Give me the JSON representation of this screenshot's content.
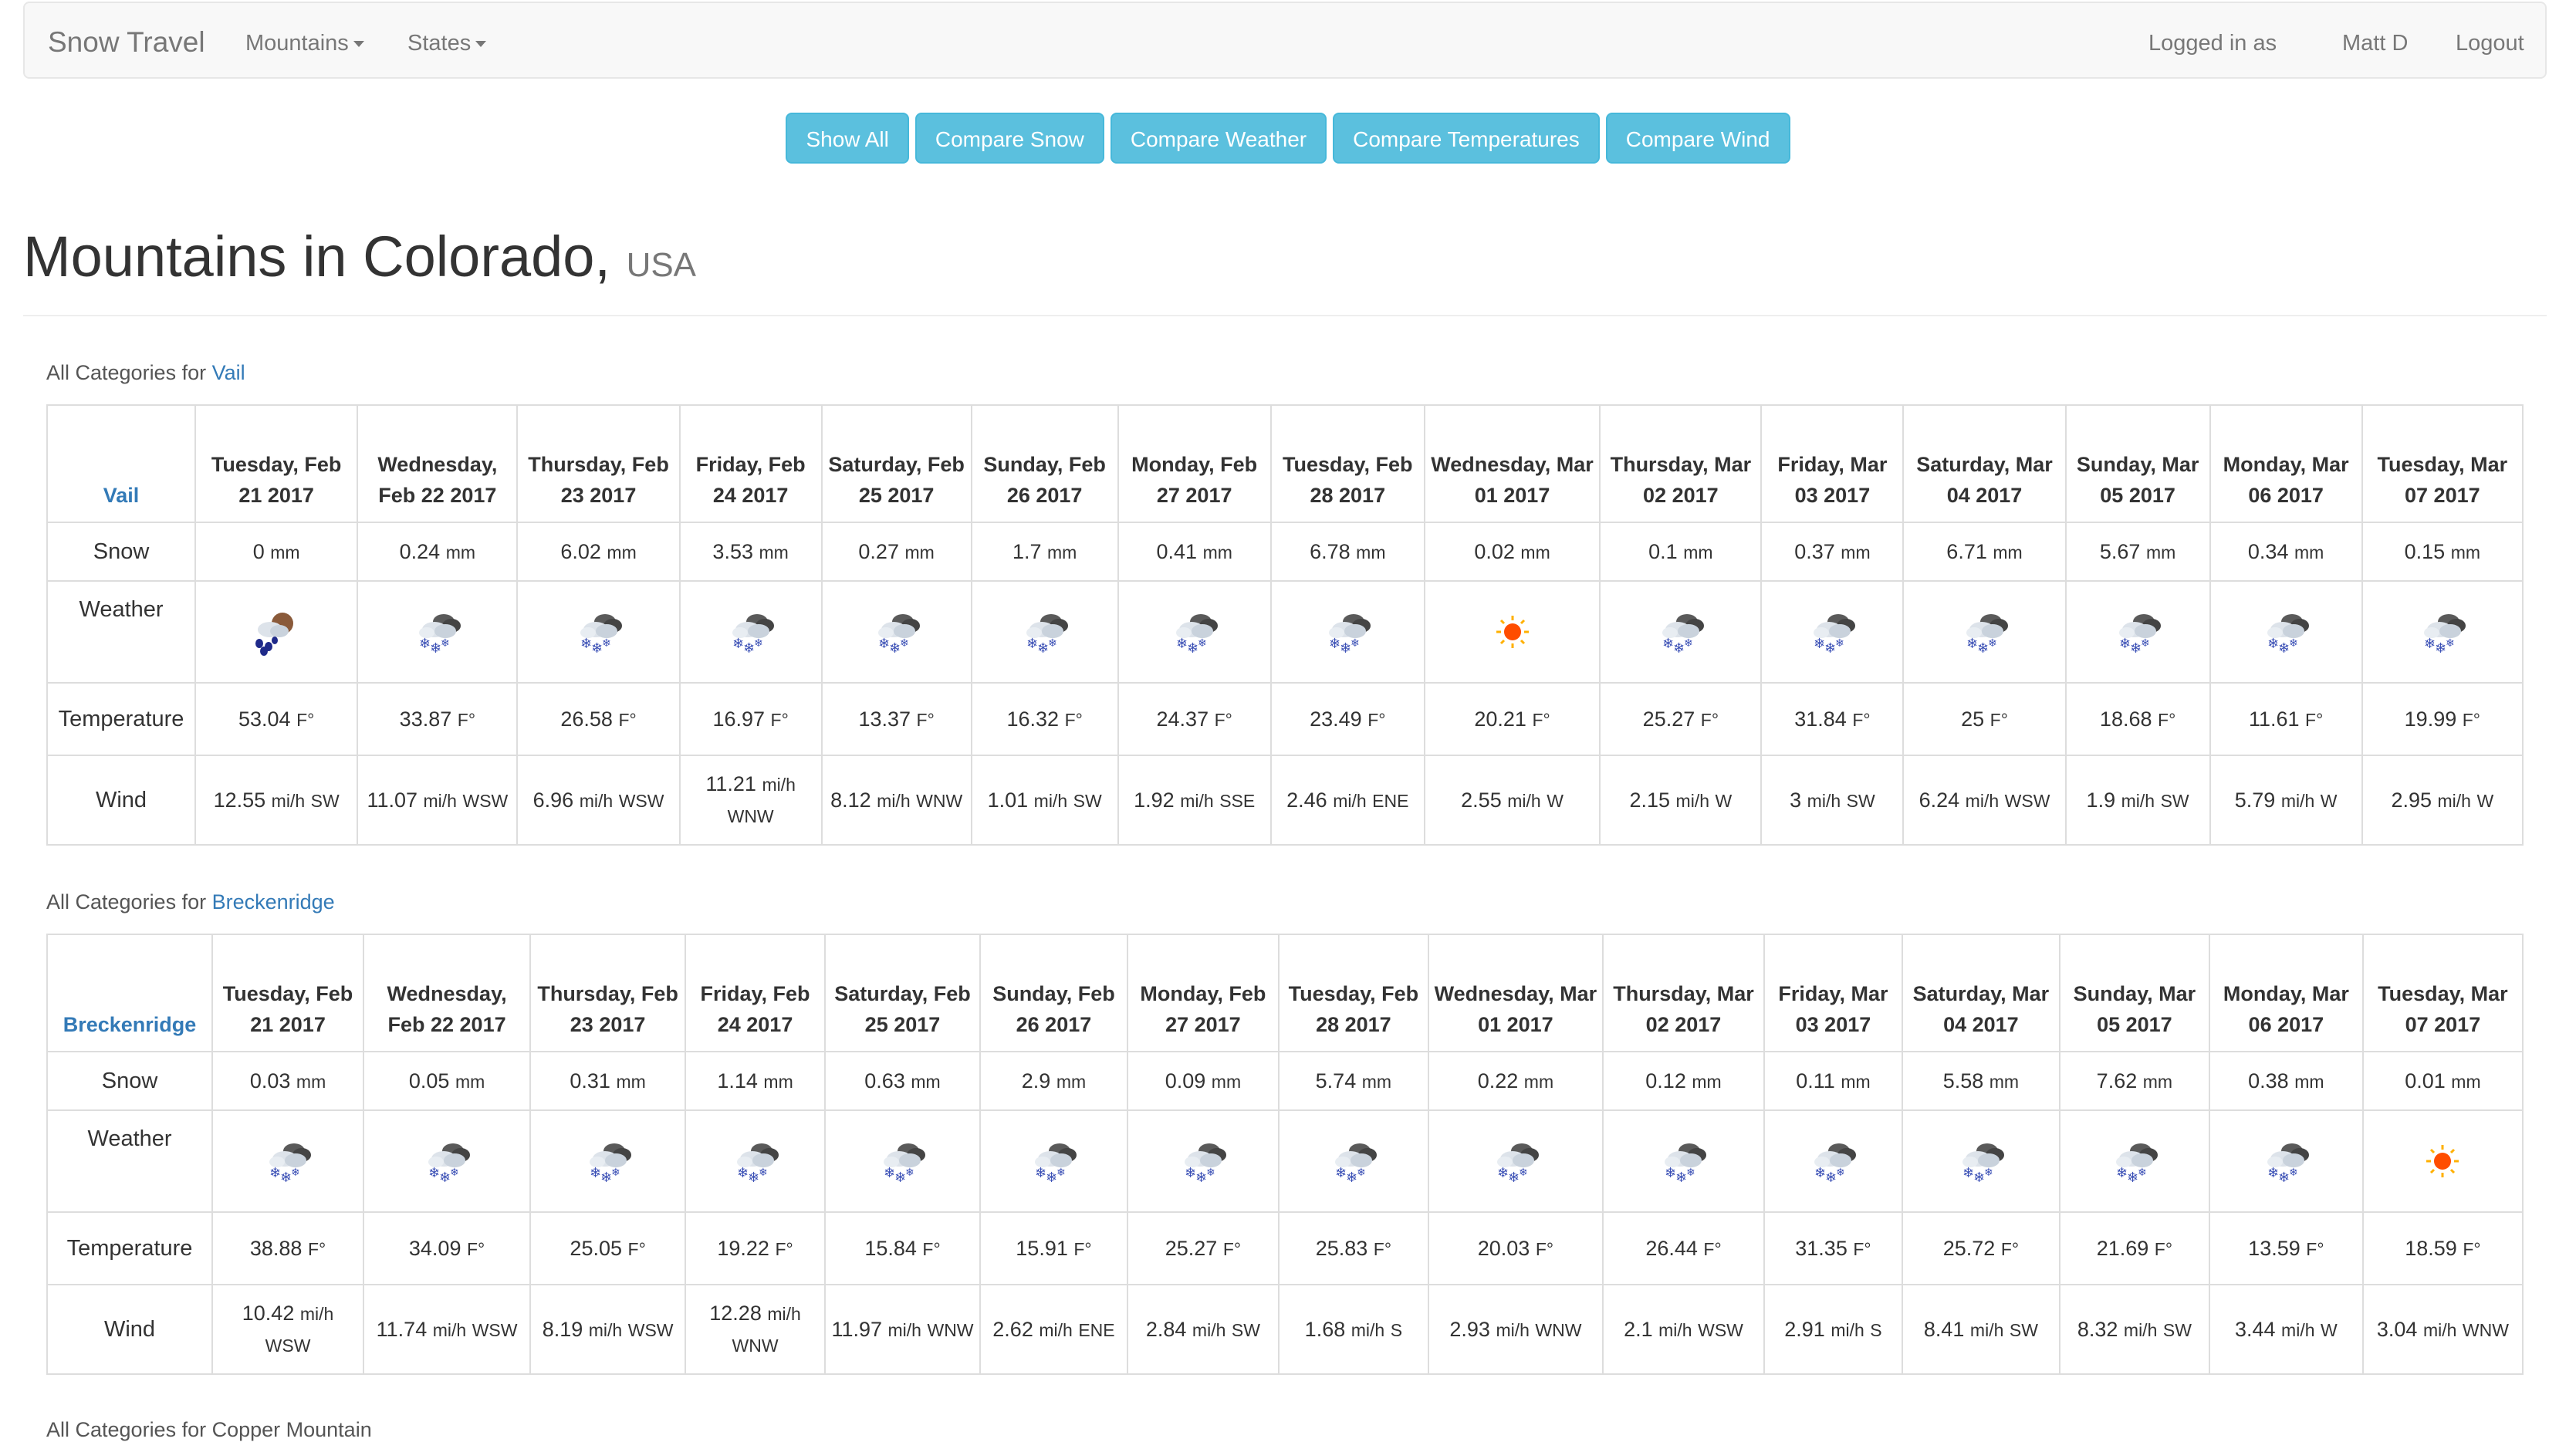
{
  "navbar": {
    "brand": "Snow Travel",
    "mountains_label": "Mountains",
    "states_label": "States",
    "logged_in_as": "Logged in as",
    "user_name": "Matt D",
    "logout": "Logout"
  },
  "buttons": [
    "Show All",
    "Compare Snow",
    "Compare Weather",
    "Compare Temperatures",
    "Compare Wind"
  ],
  "heading": {
    "title": "Mountains in Colorado,",
    "subtitle": "USA"
  },
  "row_labels": {
    "snow": "Snow",
    "weather": "Weather",
    "temperature": "Temperature",
    "wind": "Wind"
  },
  "units": {
    "snow": "mm",
    "temp": "F°",
    "wind": "mi/h"
  },
  "sections": [
    {
      "prefix": "All Categories for",
      "mountain": "Vail",
      "days": [
        "Tuesday, Feb 21 2017",
        "Wednesday, Feb 22 2017",
        "Thursday, Feb 23 2017",
        "Friday, Feb 24 2017",
        "Saturday, Feb 25 2017",
        "Sunday, Feb 26 2017",
        "Monday, Feb 27 2017",
        "Tuesday, Feb 28 2017",
        "Wednesday, Mar 01 2017",
        "Thursday, Mar 02 2017",
        "Friday, Mar 03 2017",
        "Saturday, Mar 04 2017",
        "Sunday, Mar 05 2017",
        "Monday, Mar 06 2017",
        "Tuesday, Mar 07 2017"
      ],
      "snow": [
        "0",
        "0.24",
        "6.02",
        "3.53",
        "0.27",
        "1.7",
        "0.41",
        "6.78",
        "0.02",
        "0.1",
        "0.37",
        "6.71",
        "5.67",
        "0.34",
        "0.15"
      ],
      "weather": [
        "rain-cloud-icon",
        "snow-cloud-icon",
        "snow-cloud-icon",
        "snow-cloud-icon",
        "snow-cloud-icon",
        "snow-cloud-icon",
        "snow-cloud-icon",
        "snow-cloud-icon",
        "sun-icon",
        "snow-cloud-icon",
        "snow-cloud-icon",
        "snow-cloud-icon",
        "snow-cloud-icon",
        "snow-cloud-icon",
        "snow-cloud-icon"
      ],
      "temp": [
        "53.04",
        "33.87",
        "26.58",
        "16.97",
        "13.37",
        "16.32",
        "24.37",
        "23.49",
        "20.21",
        "25.27",
        "31.84",
        "25",
        "18.68",
        "11.61",
        "19.99"
      ],
      "wind_speed": [
        "12.55",
        "11.07",
        "6.96",
        "11.21",
        "8.12",
        "1.01",
        "1.92",
        "2.46",
        "2.55",
        "2.15",
        "3",
        "6.24",
        "1.9",
        "5.79",
        "2.95"
      ],
      "wind_dir": [
        "SW",
        "WSW",
        "WSW",
        "WNW",
        "WNW",
        "SW",
        "SSE",
        "ENE",
        "W",
        "W",
        "SW",
        "WSW",
        "SW",
        "W",
        "W"
      ]
    },
    {
      "prefix": "All Categories for",
      "mountain": "Breckenridge",
      "days": [
        "Tuesday, Feb 21 2017",
        "Wednesday, Feb 22 2017",
        "Thursday, Feb 23 2017",
        "Friday, Feb 24 2017",
        "Saturday, Feb 25 2017",
        "Sunday, Feb 26 2017",
        "Monday, Feb 27 2017",
        "Tuesday, Feb 28 2017",
        "Wednesday, Mar 01 2017",
        "Thursday, Mar 02 2017",
        "Friday, Mar 03 2017",
        "Saturday, Mar 04 2017",
        "Sunday, Mar 05 2017",
        "Monday, Mar 06 2017",
        "Tuesday, Mar 07 2017"
      ],
      "snow": [
        "0.03",
        "0.05",
        "0.31",
        "1.14",
        "0.63",
        "2.9",
        "0.09",
        "5.74",
        "0.22",
        "0.12",
        "0.11",
        "5.58",
        "7.62",
        "0.38",
        "0.01"
      ],
      "weather": [
        "snow-cloud-icon",
        "snow-cloud-icon",
        "snow-cloud-icon",
        "snow-cloud-icon",
        "snow-cloud-icon",
        "snow-cloud-icon",
        "snow-cloud-icon",
        "snow-cloud-icon",
        "snow-cloud-icon",
        "snow-cloud-icon",
        "snow-cloud-icon",
        "snow-cloud-icon",
        "snow-cloud-icon",
        "snow-cloud-icon",
        "sun-icon"
      ],
      "temp": [
        "38.88",
        "34.09",
        "25.05",
        "19.22",
        "15.84",
        "15.91",
        "25.27",
        "25.83",
        "20.03",
        "26.44",
        "31.35",
        "25.72",
        "21.69",
        "13.59",
        "18.59"
      ],
      "wind_speed": [
        "10.42",
        "11.74",
        "8.19",
        "12.28",
        "11.97",
        "2.62",
        "2.84",
        "1.68",
        "2.93",
        "2.1",
        "2.91",
        "8.41",
        "8.32",
        "3.44",
        "3.04"
      ],
      "wind_dir": [
        "WSW",
        "WSW",
        "WSW",
        "WNW",
        "WNW",
        "ENE",
        "SW",
        "S",
        "WNW",
        "WSW",
        "S",
        "SW",
        "SW",
        "W",
        "WNW"
      ]
    }
  ],
  "next_section_partial": "All Categories for Copper Mountain"
}
